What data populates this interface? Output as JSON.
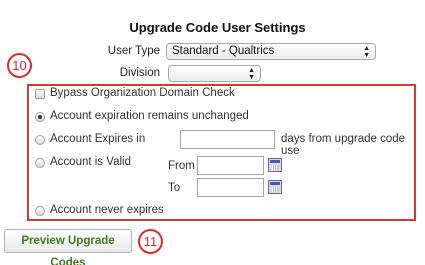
{
  "header": {
    "title": "Upgrade Code User Settings"
  },
  "fields": {
    "user_type_label": "User Type",
    "user_type_value": "Standard - Qualtrics",
    "division_label": "Division",
    "division_value": ""
  },
  "callouts": {
    "first": "10",
    "second": "11"
  },
  "options": {
    "bypass_label": "Bypass Organization Domain Check",
    "unchanged_label": "Account expiration remains unchanged",
    "expires_in_label": "Account Expires in",
    "expires_in_suffix": "days from upgrade code use",
    "is_valid_label": "Account is Valid",
    "from_label": "From",
    "to_label": "To",
    "never_expires_label": "Account never expires",
    "selected": "unchanged"
  },
  "buttons": {
    "preview_label": "Preview Upgrade Codes"
  },
  "colors": {
    "callout_red": "#d62f2f",
    "preview_text_green": "#3f7d1e"
  }
}
